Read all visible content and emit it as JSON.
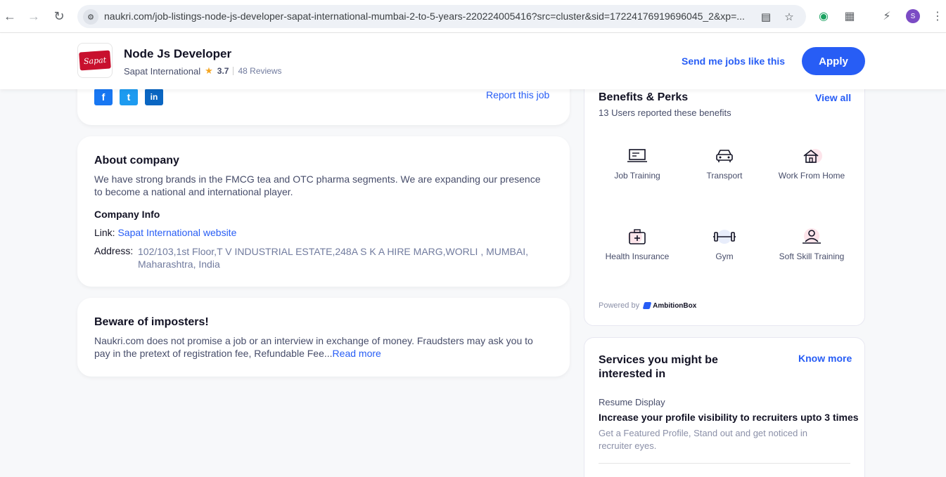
{
  "browser": {
    "url": "naukri.com/job-listings-node-js-developer-sapat-international-mumbai-2-to-5-years-220224005416?src=cluster&sid=17224176919696045_2&xp=...",
    "profile_initial": "S"
  },
  "job_header": {
    "logo_text": "Sapat",
    "title": "Node Js Developer",
    "company": "Sapat International",
    "rating": "3.7",
    "reviews": "48 Reviews",
    "send_jobs_label": "Send me jobs like this",
    "apply_label": "Apply"
  },
  "share": {
    "facebook": "f",
    "twitter": "t",
    "linkedin": "in",
    "report_label": "Report this job"
  },
  "about": {
    "heading": "About company",
    "description": "We have strong brands in the FMCG tea and OTC pharma segments. We are expanding our presence to become a national and international player.",
    "info_heading": "Company Info",
    "link_label": "Link:",
    "link_text": "Sapat International website",
    "address_label": "Address:",
    "address": "102/103,1st Floor,T V INDUSTRIAL ESTATE,248A S K A HIRE MARG,WORLI , MUMBAI, Maharashtra, India"
  },
  "beware": {
    "heading": "Beware of imposters!",
    "text": "Naukri.com does not promise a job or an interview in exchange of money. Fraudsters may ask you to pay in the pretext of registration fee, Refundable Fee...",
    "read_more": "Read more"
  },
  "benefits": {
    "title": "Benefits & Perks",
    "view_all": "View all",
    "subtitle": "13 Users reported these benefits",
    "items": [
      {
        "label": "Job Training",
        "icon": "training-icon"
      },
      {
        "label": "Transport",
        "icon": "car-icon"
      },
      {
        "label": "Work From Home",
        "icon": "home-wifi-icon"
      },
      {
        "label": "Health Insurance",
        "icon": "medical-kit-icon"
      },
      {
        "label": "Gym",
        "icon": "dumbbell-icon"
      },
      {
        "label": "Soft Skill Training",
        "icon": "presenter-icon"
      }
    ],
    "powered_by": "Powered by",
    "ambitionbox": "AmbitionBox"
  },
  "services": {
    "title": "Services you might be interested in",
    "know_more": "Know more",
    "category": "Resume Display",
    "headline": "Increase your profile visibility to recruiters upto 3 times",
    "description": "Get a Featured Profile, Stand out and get noticed in recruiter eyes."
  }
}
